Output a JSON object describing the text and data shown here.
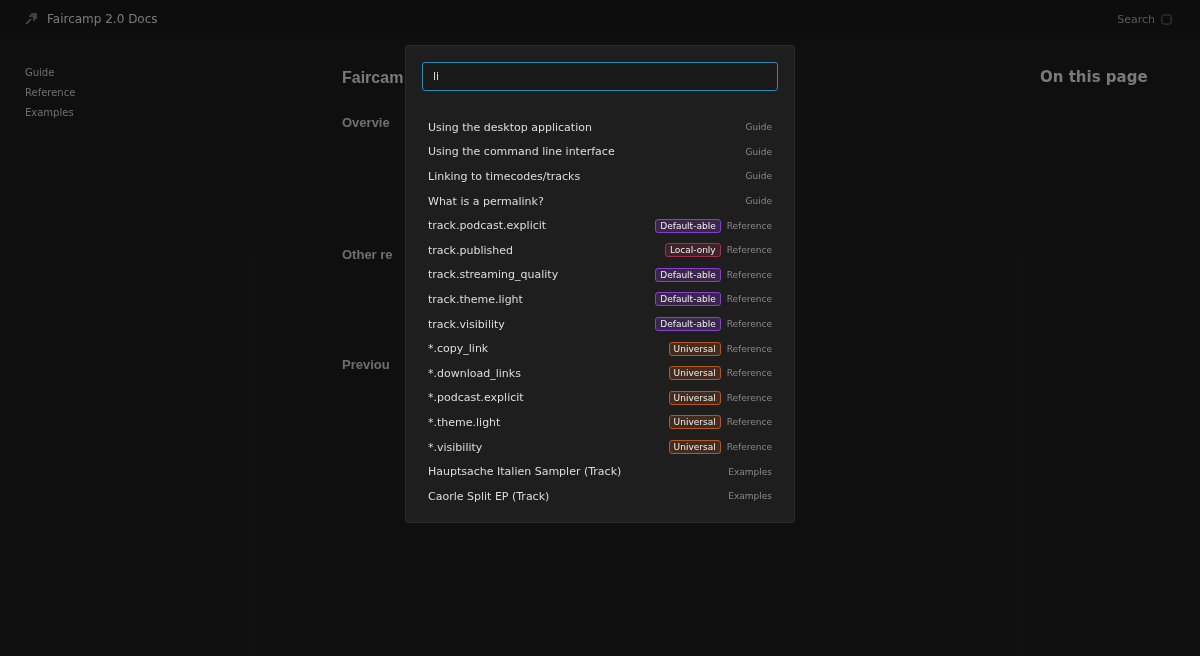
{
  "header": {
    "title": "Faircamp 2.0 Docs",
    "search_label": "Search"
  },
  "sidebar": {
    "items": [
      "Guide",
      "Reference",
      "Examples"
    ]
  },
  "main": {
    "headings": [
      {
        "text": "Faircam",
        "kind": "title"
      },
      {
        "text": "Overvie",
        "kind": "section"
      },
      {
        "text": "Other re",
        "kind": "section"
      },
      {
        "text": "Previou",
        "kind": "section"
      }
    ]
  },
  "toc": {
    "title": "On this page"
  },
  "search_dialog": {
    "query": "li",
    "results": [
      {
        "title": "Using the desktop application",
        "section": "Guide"
      },
      {
        "title": "Using the command line interface",
        "section": "Guide"
      },
      {
        "title": "Linking to timecodes/tracks",
        "section": "Guide"
      },
      {
        "title": "What is a permalink?",
        "section": "Guide"
      },
      {
        "title": "track.podcast.explicit",
        "tag": {
          "label": "Default-able",
          "color": "#8b3fd1"
        },
        "section": "Reference"
      },
      {
        "title": "track.published",
        "tag": {
          "label": "Local-only",
          "color": "#a3304a"
        },
        "section": "Reference"
      },
      {
        "title": "track.streaming_quality",
        "tag": {
          "label": "Default-able",
          "color": "#8b3fd1"
        },
        "section": "Reference"
      },
      {
        "title": "track.theme.light",
        "tag": {
          "label": "Default-able",
          "color": "#8b3fd1"
        },
        "section": "Reference"
      },
      {
        "title": "track.visibility",
        "tag": {
          "label": "Default-able",
          "color": "#8b3fd1"
        },
        "section": "Reference"
      },
      {
        "title": "*.copy_link",
        "tag": {
          "label": "Universal",
          "color": "#b5581f"
        },
        "section": "Reference"
      },
      {
        "title": "*.download_links",
        "tag": {
          "label": "Universal",
          "color": "#b5581f"
        },
        "section": "Reference"
      },
      {
        "title": "*.podcast.explicit",
        "tag": {
          "label": "Universal",
          "color": "#b5581f"
        },
        "section": "Reference"
      },
      {
        "title": "*.theme.light",
        "tag": {
          "label": "Universal",
          "color": "#b5581f"
        },
        "section": "Reference"
      },
      {
        "title": "*.visibility",
        "tag": {
          "label": "Universal",
          "color": "#b5581f"
        },
        "section": "Reference"
      },
      {
        "title": "Hauptsache Italien Sampler (Track)",
        "section": "Examples"
      },
      {
        "title": "Caorle Split EP (Track)",
        "section": "Examples"
      }
    ]
  }
}
